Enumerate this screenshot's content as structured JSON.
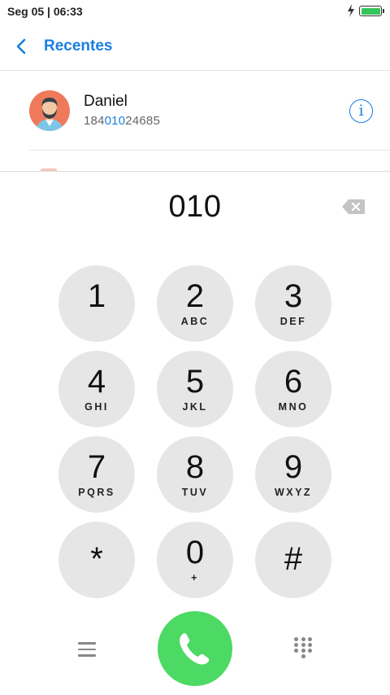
{
  "status_bar": {
    "time": "Seg 05 | 06:33",
    "battery_color": "#35c659"
  },
  "header": {
    "title": "Recentes",
    "back_icon": "chevron-left-icon",
    "accent_color": "#1a7fe0"
  },
  "contact": {
    "name": "Daniel",
    "number_prefix": "184",
    "number_match": "010",
    "number_suffix": "24685",
    "info_label": "i"
  },
  "dialer": {
    "entered_number": "010",
    "keys": [
      {
        "digit": "1",
        "letters": ""
      },
      {
        "digit": "2",
        "letters": "ABC"
      },
      {
        "digit": "3",
        "letters": "DEF"
      },
      {
        "digit": "4",
        "letters": "GHI"
      },
      {
        "digit": "5",
        "letters": "JKL"
      },
      {
        "digit": "6",
        "letters": "MNO"
      },
      {
        "digit": "7",
        "letters": "PQRS"
      },
      {
        "digit": "8",
        "letters": "TUV"
      },
      {
        "digit": "9",
        "letters": "WXYZ"
      },
      {
        "digit": "*",
        "letters": ""
      },
      {
        "digit": "0",
        "letters": "+"
      },
      {
        "digit": "#",
        "letters": ""
      }
    ],
    "call_color": "#4cd964"
  }
}
